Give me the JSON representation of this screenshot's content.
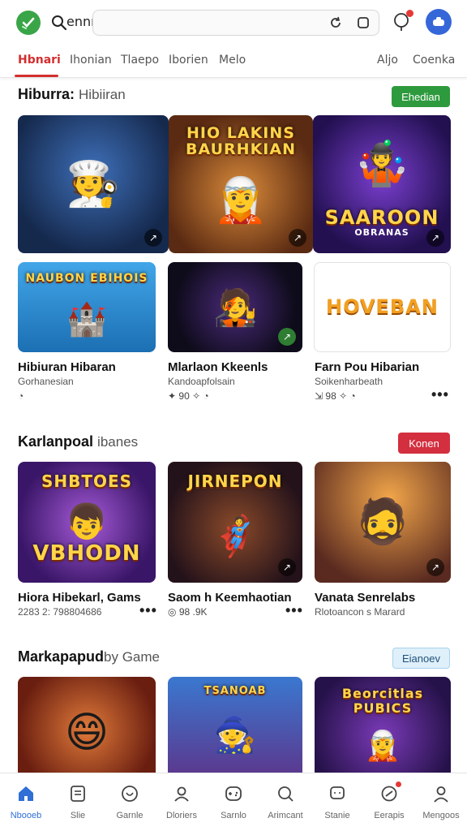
{
  "search": {
    "query": "ennnnunn"
  },
  "tabs": [
    {
      "label": "Hbnari"
    },
    {
      "label": "Ihonian"
    },
    {
      "label": "Tlaepo"
    },
    {
      "label": "Iborien"
    },
    {
      "label": "Melo"
    },
    {
      "label": "Aljo"
    },
    {
      "label": "Coenka"
    }
  ],
  "section1": {
    "title": "Hiburra:",
    "subtitle": "Hibiiran",
    "action": "Ehedian",
    "action_color": "#2e9a3e",
    "hero_cards": [
      {
        "art_title": "",
        "icon": "chef-character"
      },
      {
        "art_title": "HIO LAKINS BAURHKIAN",
        "icon": "hero-character"
      },
      {
        "art_title": "SAAROON",
        "art_sub": "OBRANAS",
        "icon": "jester-character"
      }
    ],
    "cards": [
      {
        "art_title": "NAUBON EBIHOIS",
        "title": "Hibiuran Hibaran",
        "sub": "Gorhanesian",
        "stats": ""
      },
      {
        "art_title": "",
        "title": "Mlarlaon Kkeenls",
        "sub": "Kandoapfolsain",
        "stats": "90"
      },
      {
        "art_title": "HOVEBAN",
        "title": "Farn Pou Hibarian",
        "sub": "Soikenharbeath",
        "stats": "98"
      }
    ]
  },
  "section2": {
    "title": "Karlanpoal",
    "subtitle": "ibanes",
    "action": "Konen",
    "action_color": "#d32f3f",
    "cards": [
      {
        "art_title": "SHBTOES",
        "art_sub": "VBHODN",
        "title": "Hiora Hibekarl, Gams",
        "sub": "2283 2: 798804686",
        "stats": ""
      },
      {
        "art_title": "JIRNEPON",
        "title": "Saom h Keemhaotian",
        "sub": "",
        "stats": "98 .9K"
      },
      {
        "art_title": "",
        "title": "Vanata Senrelabs",
        "sub": "Rlotoancon s Marard",
        "stats": ""
      }
    ]
  },
  "section3": {
    "title": "Markapapud",
    "subtitle": "by Game",
    "action": "Eianoev",
    "action_color": "#dff0fa",
    "cards": [
      {
        "art_title": ""
      },
      {
        "art_title": "TSANOAB"
      },
      {
        "art_title": "Beorcitlas PUBICS"
      }
    ]
  },
  "bottom_nav": [
    {
      "label": "Nbooeb",
      "icon": "home-icon"
    },
    {
      "label": "Slie",
      "icon": "list-icon"
    },
    {
      "label": "Garnle",
      "icon": "heart-icon"
    },
    {
      "label": "Dloriers",
      "icon": "user-icon"
    },
    {
      "label": "Sarnlo",
      "icon": "gamepad-icon"
    },
    {
      "label": "Arimcant",
      "icon": "search-icon"
    },
    {
      "label": "Stanie",
      "icon": "chat-icon"
    },
    {
      "label": "Eerapis",
      "icon": "badge-icon"
    },
    {
      "label": "Mengoos",
      "icon": "profile-icon"
    }
  ]
}
